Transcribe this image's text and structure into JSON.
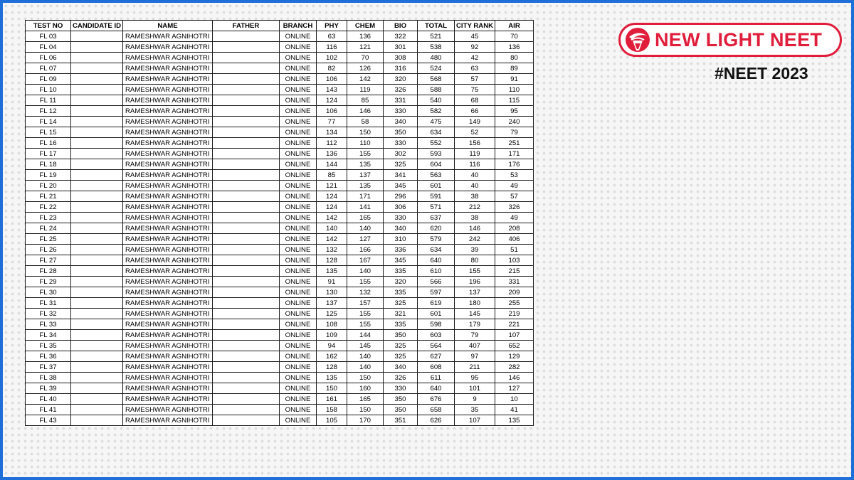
{
  "brand": {
    "logo_text": "NEW LIGHT NEET",
    "hashtag": "#NEET 2023",
    "accent_color": "#e01e3c",
    "frame_color": "#1e6fd9",
    "logo_icon": "torch-flame-logo-icon"
  },
  "table": {
    "columns": [
      "TEST NO",
      "CANDIDATE ID",
      "NAME",
      "FATHER",
      "BRANCH",
      "PHY",
      "CHEM",
      "BIO",
      "TOTAL",
      "CITY RANK",
      "AIR"
    ],
    "rows": [
      [
        "FL 03",
        "",
        "RAMESHWAR AGNIHOTRI",
        "",
        "ONLINE",
        "63",
        "136",
        "322",
        "521",
        "45",
        "70"
      ],
      [
        "FL 04",
        "",
        "RAMESHWAR AGNIHOTRI",
        "",
        "ONLINE",
        "116",
        "121",
        "301",
        "538",
        "92",
        "136"
      ],
      [
        "FL 06",
        "",
        "RAMESHWAR AGNIHOTRI",
        "",
        "ONLINE",
        "102",
        "70",
        "308",
        "480",
        "42",
        "80"
      ],
      [
        "FL 07",
        "",
        "RAMESHWAR AGNIHOTRI",
        "",
        "ONLINE",
        "82",
        "126",
        "316",
        "524",
        "63",
        "89"
      ],
      [
        "FL 09",
        "",
        "RAMESHWAR AGNIHOTRI",
        "",
        "ONLINE",
        "106",
        "142",
        "320",
        "568",
        "57",
        "91"
      ],
      [
        "FL 10",
        "",
        "RAMESHWAR AGNIHOTRI",
        "",
        "ONLINE",
        "143",
        "119",
        "326",
        "588",
        "75",
        "110"
      ],
      [
        "FL 11",
        "",
        "RAMESHWAR AGNIHOTRI",
        "",
        "ONLINE",
        "124",
        "85",
        "331",
        "540",
        "68",
        "115"
      ],
      [
        "FL 12",
        "",
        "RAMESHWAR AGNIHOTRI",
        "",
        "ONLINE",
        "106",
        "146",
        "330",
        "582",
        "66",
        "95"
      ],
      [
        "FL 14",
        "",
        "RAMESHWAR AGNIHOTRI",
        "",
        "ONLINE",
        "77",
        "58",
        "340",
        "475",
        "149",
        "240"
      ],
      [
        "FL 15",
        "",
        "RAMESHWAR AGNIHOTRI",
        "",
        "ONLINE",
        "134",
        "150",
        "350",
        "634",
        "52",
        "79"
      ],
      [
        "FL 16",
        "",
        "RAMESHWAR AGNIHOTRI",
        "",
        "ONLINE",
        "112",
        "110",
        "330",
        "552",
        "156",
        "251"
      ],
      [
        "FL 17",
        "",
        "RAMESHWAR AGNIHOTRI",
        "",
        "ONLINE",
        "136",
        "155",
        "302",
        "593",
        "119",
        "171"
      ],
      [
        "FL 18",
        "",
        "RAMESHWAR AGNIHOTRI",
        "",
        "ONLINE",
        "144",
        "135",
        "325",
        "604",
        "116",
        "176"
      ],
      [
        "FL 19",
        "",
        "RAMESHWAR AGNIHOTRI",
        "",
        "ONLINE",
        "85",
        "137",
        "341",
        "563",
        "40",
        "53"
      ],
      [
        "FL 20",
        "",
        "RAMESHWAR AGNIHOTRI",
        "",
        "ONLINE",
        "121",
        "135",
        "345",
        "601",
        "40",
        "49"
      ],
      [
        "FL 21",
        "",
        "RAMESHWAR AGNIHOTRI",
        "",
        "ONLINE",
        "124",
        "171",
        "296",
        "591",
        "38",
        "57"
      ],
      [
        "FL 22",
        "",
        "RAMESHWAR AGNIHOTRI",
        "",
        "ONLINE",
        "124",
        "141",
        "306",
        "571",
        "212",
        "326"
      ],
      [
        "FL 23",
        "",
        "RAMESHWAR AGNIHOTRI",
        "",
        "ONLINE",
        "142",
        "165",
        "330",
        "637",
        "38",
        "49"
      ],
      [
        "FL 24",
        "",
        "RAMESHWAR AGNIHOTRI",
        "",
        "ONLINE",
        "140",
        "140",
        "340",
        "620",
        "146",
        "208"
      ],
      [
        "FL 25",
        "",
        "RAMESHWAR AGNIHOTRI",
        "",
        "ONLINE",
        "142",
        "127",
        "310",
        "579",
        "242",
        "406"
      ],
      [
        "FL 26",
        "",
        "RAMESHWAR AGNIHOTRI",
        "",
        "ONLINE",
        "132",
        "166",
        "336",
        "634",
        "39",
        "51"
      ],
      [
        "FL 27",
        "",
        "RAMESHWAR AGNIHOTRI",
        "",
        "ONLINE",
        "128",
        "167",
        "345",
        "640",
        "80",
        "103"
      ],
      [
        "FL 28",
        "",
        "RAMESHWAR AGNIHOTRI",
        "",
        "ONLINE",
        "135",
        "140",
        "335",
        "610",
        "155",
        "215"
      ],
      [
        "FL 29",
        "",
        "RAMESHWAR AGNIHOTRI",
        "",
        "ONLINE",
        "91",
        "155",
        "320",
        "566",
        "196",
        "331"
      ],
      [
        "FL 30",
        "",
        "RAMESHWAR AGNIHOTRI",
        "",
        "ONLINE",
        "130",
        "132",
        "335",
        "597",
        "137",
        "209"
      ],
      [
        "FL 31",
        "",
        "RAMESHWAR AGNIHOTRI",
        "",
        "ONLINE",
        "137",
        "157",
        "325",
        "619",
        "180",
        "255"
      ],
      [
        "FL 32",
        "",
        "RAMESHWAR AGNIHOTRI",
        "",
        "ONLINE",
        "125",
        "155",
        "321",
        "601",
        "145",
        "219"
      ],
      [
        "FL 33",
        "",
        "RAMESHWAR AGNIHOTRI",
        "",
        "ONLINE",
        "108",
        "155",
        "335",
        "598",
        "179",
        "221"
      ],
      [
        "FL 34",
        "",
        "RAMESHWAR AGNIHOTRI",
        "",
        "ONLINE",
        "109",
        "144",
        "350",
        "603",
        "79",
        "107"
      ],
      [
        "FL 35",
        "",
        "RAMESHWAR AGNIHOTRI",
        "",
        "ONLINE",
        "94",
        "145",
        "325",
        "564",
        "407",
        "652"
      ],
      [
        "FL 36",
        "",
        "RAMESHWAR AGNIHOTRI",
        "",
        "ONLINE",
        "162",
        "140",
        "325",
        "627",
        "97",
        "129"
      ],
      [
        "FL 37",
        "",
        "RAMESHWAR AGNIHOTRI",
        "",
        "ONLINE",
        "128",
        "140",
        "340",
        "608",
        "211",
        "282"
      ],
      [
        "FL 38",
        "",
        "RAMESHWAR AGNIHOTRI",
        "",
        "ONLINE",
        "135",
        "150",
        "326",
        "611",
        "95",
        "146"
      ],
      [
        "FL 39",
        "",
        "RAMESHWAR AGNIHOTRI",
        "",
        "ONLINE",
        "150",
        "160",
        "330",
        "640",
        "101",
        "127"
      ],
      [
        "FL 40",
        "",
        "RAMESHWAR AGNIHOTRI",
        "",
        "ONLINE",
        "161",
        "165",
        "350",
        "676",
        "9",
        "10"
      ],
      [
        "FL 41",
        "",
        "RAMESHWAR AGNIHOTRI",
        "",
        "ONLINE",
        "158",
        "150",
        "350",
        "658",
        "35",
        "41"
      ],
      [
        "FL 43",
        "",
        "RAMESHWAR AGNIHOTRI",
        "",
        "ONLINE",
        "105",
        "170",
        "351",
        "626",
        "107",
        "135"
      ]
    ]
  }
}
